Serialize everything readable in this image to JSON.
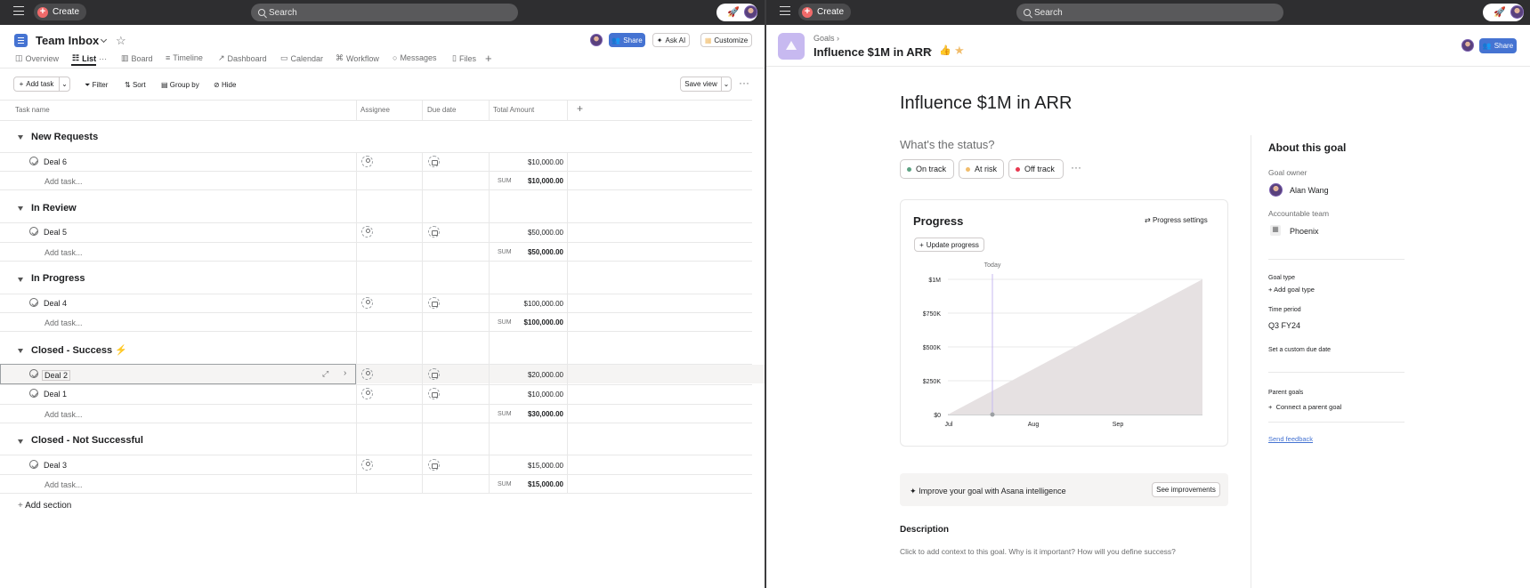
{
  "left": {
    "topbar": {
      "create_label": "Create",
      "search_placeholder": "Search"
    },
    "project": {
      "title": "Team Inbox"
    },
    "header_buttons": {
      "share": "Share",
      "ask_ai": "Ask AI",
      "customize": "Customize"
    },
    "tabs": [
      {
        "label": "Overview"
      },
      {
        "label": "List"
      },
      {
        "label": "Board"
      },
      {
        "label": "Timeline"
      },
      {
        "label": "Dashboard"
      },
      {
        "label": "Calendar"
      },
      {
        "label": "Workflow"
      },
      {
        "label": "Messages"
      },
      {
        "label": "Files"
      }
    ],
    "toolbar": {
      "add_task": "Add task",
      "filter": "Filter",
      "sort": "Sort",
      "group_by": "Group by",
      "hide": "Hide",
      "save_view": "Save view"
    },
    "columns": {
      "task_name": "Task name",
      "assignee": "Assignee",
      "due_date": "Due date",
      "total_amount": "Total Amount"
    },
    "add_task_placeholder": "Add task...",
    "sum_label": "SUM",
    "sections": [
      {
        "name": "New Requests",
        "tasks": [
          {
            "name": "Deal 6",
            "amount": "$10,000.00"
          }
        ],
        "sum": "$10,000.00"
      },
      {
        "name": "In Review",
        "tasks": [
          {
            "name": "Deal 5",
            "amount": "$50,000.00"
          }
        ],
        "sum": "$50,000.00"
      },
      {
        "name": "In Progress",
        "tasks": [
          {
            "name": "Deal 4",
            "amount": "$100,000.00"
          }
        ],
        "sum": "$100,000.00"
      },
      {
        "name": "Closed - Success",
        "emoji": "⚡",
        "tasks": [
          {
            "name": "Deal 2",
            "amount": "$20,000.00"
          },
          {
            "name": "Deal 1",
            "amount": "$10,000.00"
          }
        ],
        "sum": "$30,000.00"
      },
      {
        "name": "Closed - Not Successful",
        "tasks": [
          {
            "name": "Deal 3",
            "amount": "$15,000.00"
          }
        ],
        "sum": "$15,000.00"
      }
    ],
    "add_section": "Add section"
  },
  "right": {
    "topbar": {
      "create_label": "Create",
      "search_placeholder": "Search"
    },
    "breadcrumb": "Goals",
    "goal_title": "Influence $1M in ARR",
    "share": "Share",
    "big_title": "Influence $1M in ARR",
    "status_question": "What's the status?",
    "status_options": [
      {
        "label": "On track",
        "color": "#5da283"
      },
      {
        "label": "At risk",
        "color": "#f1bd6c"
      },
      {
        "label": "Off track",
        "color": "#e8384f"
      }
    ],
    "progress": {
      "title": "Progress",
      "settings": "Progress settings",
      "update": "Update progress",
      "today_label": "Today"
    },
    "chart_data": {
      "type": "area",
      "x": [
        "Jul",
        "Aug",
        "Sep"
      ],
      "y_ticks": [
        "$0",
        "$250K",
        "$500K",
        "$750K",
        "$1M"
      ],
      "ylim": [
        0,
        1000000
      ],
      "series": [
        {
          "values_start": 0,
          "values_end": 1000000
        }
      ],
      "fill_color": "#e6e1e2"
    },
    "intelligence": {
      "text": "Improve your goal with Asana intelligence",
      "button": "See improvements"
    },
    "description": {
      "title": "Description",
      "placeholder": "Click to add context to this goal. Why is it important? How will you define success?"
    },
    "about": {
      "title": "About this goal",
      "goal_owner_label": "Goal owner",
      "goal_owner": "Alan Wang",
      "team_label": "Accountable team",
      "team": "Phoenix",
      "goal_type_label": "Goal type",
      "add_goal_type": "Add goal type",
      "time_period_label": "Time period",
      "time_period": "Q3 FY24",
      "custom_due": "Set a custom due date",
      "parent_goals_label": "Parent goals",
      "connect_parent": "Connect a parent goal",
      "feedback": "Send feedback"
    }
  }
}
